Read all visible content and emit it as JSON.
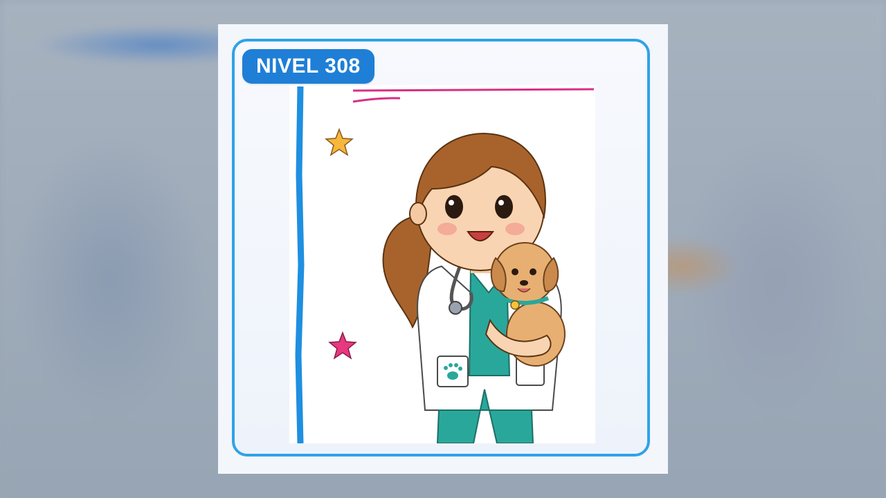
{
  "level": {
    "label": "NIVEL 308"
  },
  "illustration": {
    "subject": "vet-girl-with-puppy-icon",
    "accent_colors": {
      "frame": "#2ea3e8",
      "badge": "#1f7fd6",
      "scrubs": "#2aa79b",
      "hair": "#a8632c",
      "puppy": "#e7b072"
    }
  }
}
